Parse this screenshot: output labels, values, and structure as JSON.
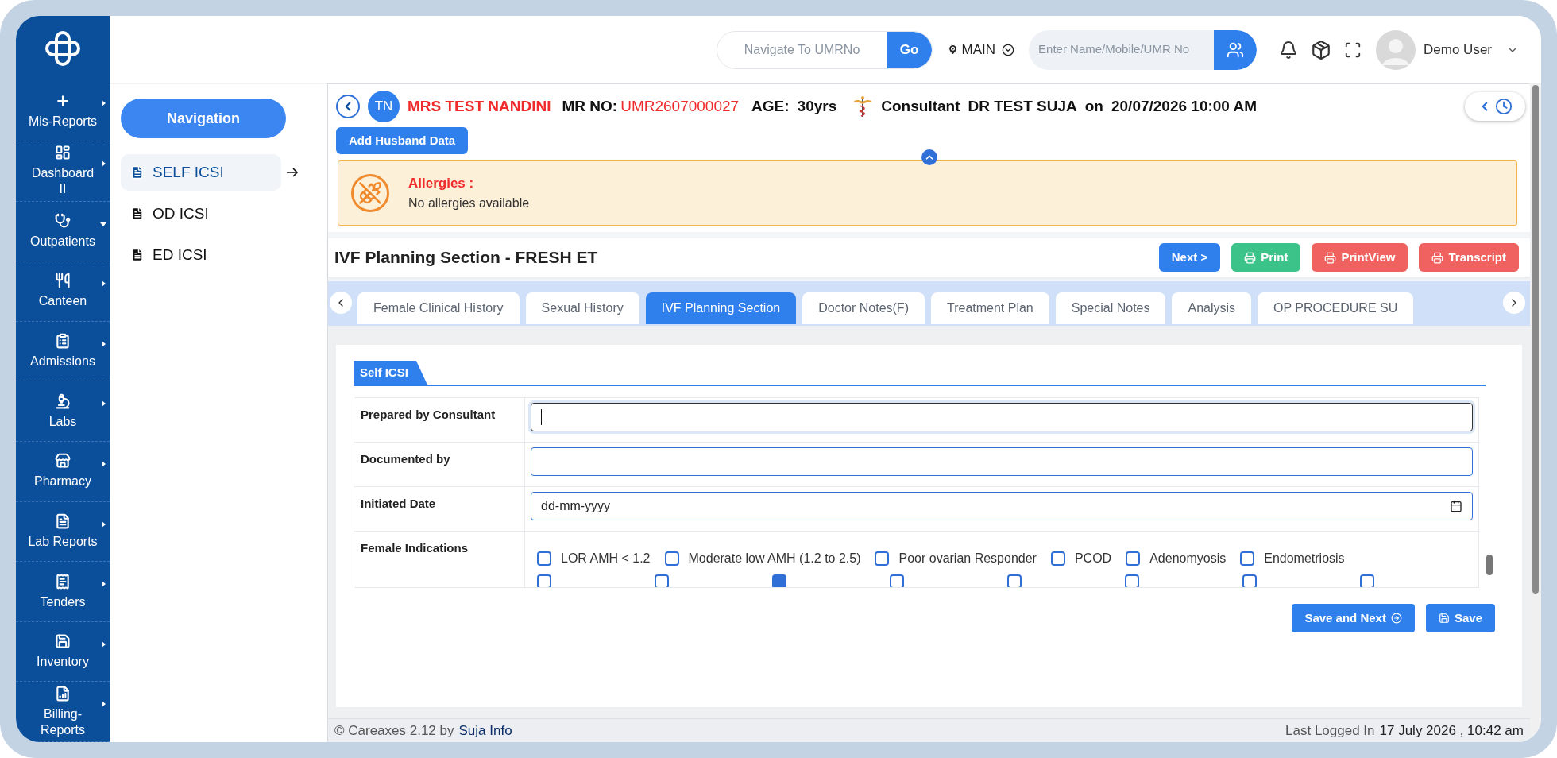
{
  "sidebar": {
    "items": [
      {
        "label": "Mis-Reports",
        "expanded": false
      },
      {
        "label": "Dashboard II",
        "expanded": false
      },
      {
        "label": "Outpatients",
        "expanded": true
      },
      {
        "label": "Canteen",
        "expanded": false
      },
      {
        "label": "Admissions",
        "expanded": false
      },
      {
        "label": "Labs",
        "expanded": false
      },
      {
        "label": "Pharmacy",
        "expanded": false
      },
      {
        "label": "Lab Reports",
        "expanded": false
      },
      {
        "label": "Tenders",
        "expanded": false
      },
      {
        "label": "Inventory",
        "expanded": false
      },
      {
        "label": "Billing-Reports",
        "expanded": false
      }
    ]
  },
  "topbar": {
    "umr_search": {
      "placeholder": "Navigate To UMRNo"
    },
    "go_button": "Go",
    "location": "MAIN",
    "patient_search": {
      "placeholder": "Enter Name/Mobile/UMR No"
    },
    "user_name": "Demo User"
  },
  "navigation": {
    "title": "Navigation",
    "items": [
      {
        "label": "SELF ICSI",
        "selected": true
      },
      {
        "label": "OD ICSI",
        "selected": false
      },
      {
        "label": "ED ICSI",
        "selected": false
      }
    ]
  },
  "patient": {
    "initials": "TN",
    "name": "MRS TEST NANDINI",
    "mr_label": "MR NO:",
    "mr_no": "UMR2607000027",
    "age_label": "AGE:",
    "age": "30yrs",
    "consultant_label": "Consultant",
    "consultant": "DR TEST SUJA",
    "on": "on",
    "datetime": "20/07/2026 10:00 AM"
  },
  "add_husband_button": "Add Husband Data",
  "allergies": {
    "title": "Allergies :",
    "text": "No allergies available"
  },
  "section": {
    "title": "IVF Planning Section - FRESH ET",
    "actions": [
      {
        "label": "Next >",
        "kind": "primary"
      },
      {
        "label": "Print",
        "kind": "success"
      },
      {
        "label": "PrintView",
        "kind": "danger"
      },
      {
        "label": "Transcript",
        "kind": "danger"
      }
    ]
  },
  "tabs": [
    {
      "label": "Female Clinical History",
      "selected": false
    },
    {
      "label": "Sexual History",
      "selected": false
    },
    {
      "label": "IVF Planning Section",
      "selected": true
    },
    {
      "label": "Doctor Notes(F)",
      "selected": false
    },
    {
      "label": "Treatment Plan",
      "selected": false
    },
    {
      "label": "Special Notes",
      "selected": false
    },
    {
      "label": "Analysis",
      "selected": false
    },
    {
      "label": "OP PROCEDURE SU",
      "selected": false
    }
  ],
  "form": {
    "tab_title": "Self ICSI",
    "fields": [
      {
        "label": "Prepared by Consultant",
        "kind": "text",
        "focused": true
      },
      {
        "label": "Documented by",
        "kind": "text",
        "focused": false
      },
      {
        "label": "Initiated Date",
        "kind": "date",
        "placeholder": "dd-mm-yyyy"
      },
      {
        "label": "Female Indications",
        "kind": "checkboxes",
        "options": [
          {
            "label": "LOR AMH < 1.2",
            "checked": false
          },
          {
            "label": "Moderate low AMH (1.2 to 2.5)",
            "checked": false
          },
          {
            "label": "Poor ovarian Responder",
            "checked": false
          },
          {
            "label": "PCOD",
            "checked": false
          },
          {
            "label": "Adenomyosis",
            "checked": false
          },
          {
            "label": "Endometriosis",
            "checked": false
          }
        ],
        "more_options": [
          {
            "checked": false
          },
          {
            "checked": false
          },
          {
            "checked": true
          },
          {
            "checked": false
          },
          {
            "checked": false
          },
          {
            "checked": false
          },
          {
            "checked": false
          },
          {
            "checked": false
          }
        ]
      }
    ],
    "buttons": [
      {
        "label": "Save and Next",
        "kind": "next"
      },
      {
        "label": "Save",
        "kind": "save"
      }
    ]
  },
  "footer": {
    "copyright": "© Careaxes 2.12 by",
    "company": "Suja Info",
    "last_logged_label": "Last Logged In",
    "last_logged": "17 July 2026 , 10:42 am"
  }
}
